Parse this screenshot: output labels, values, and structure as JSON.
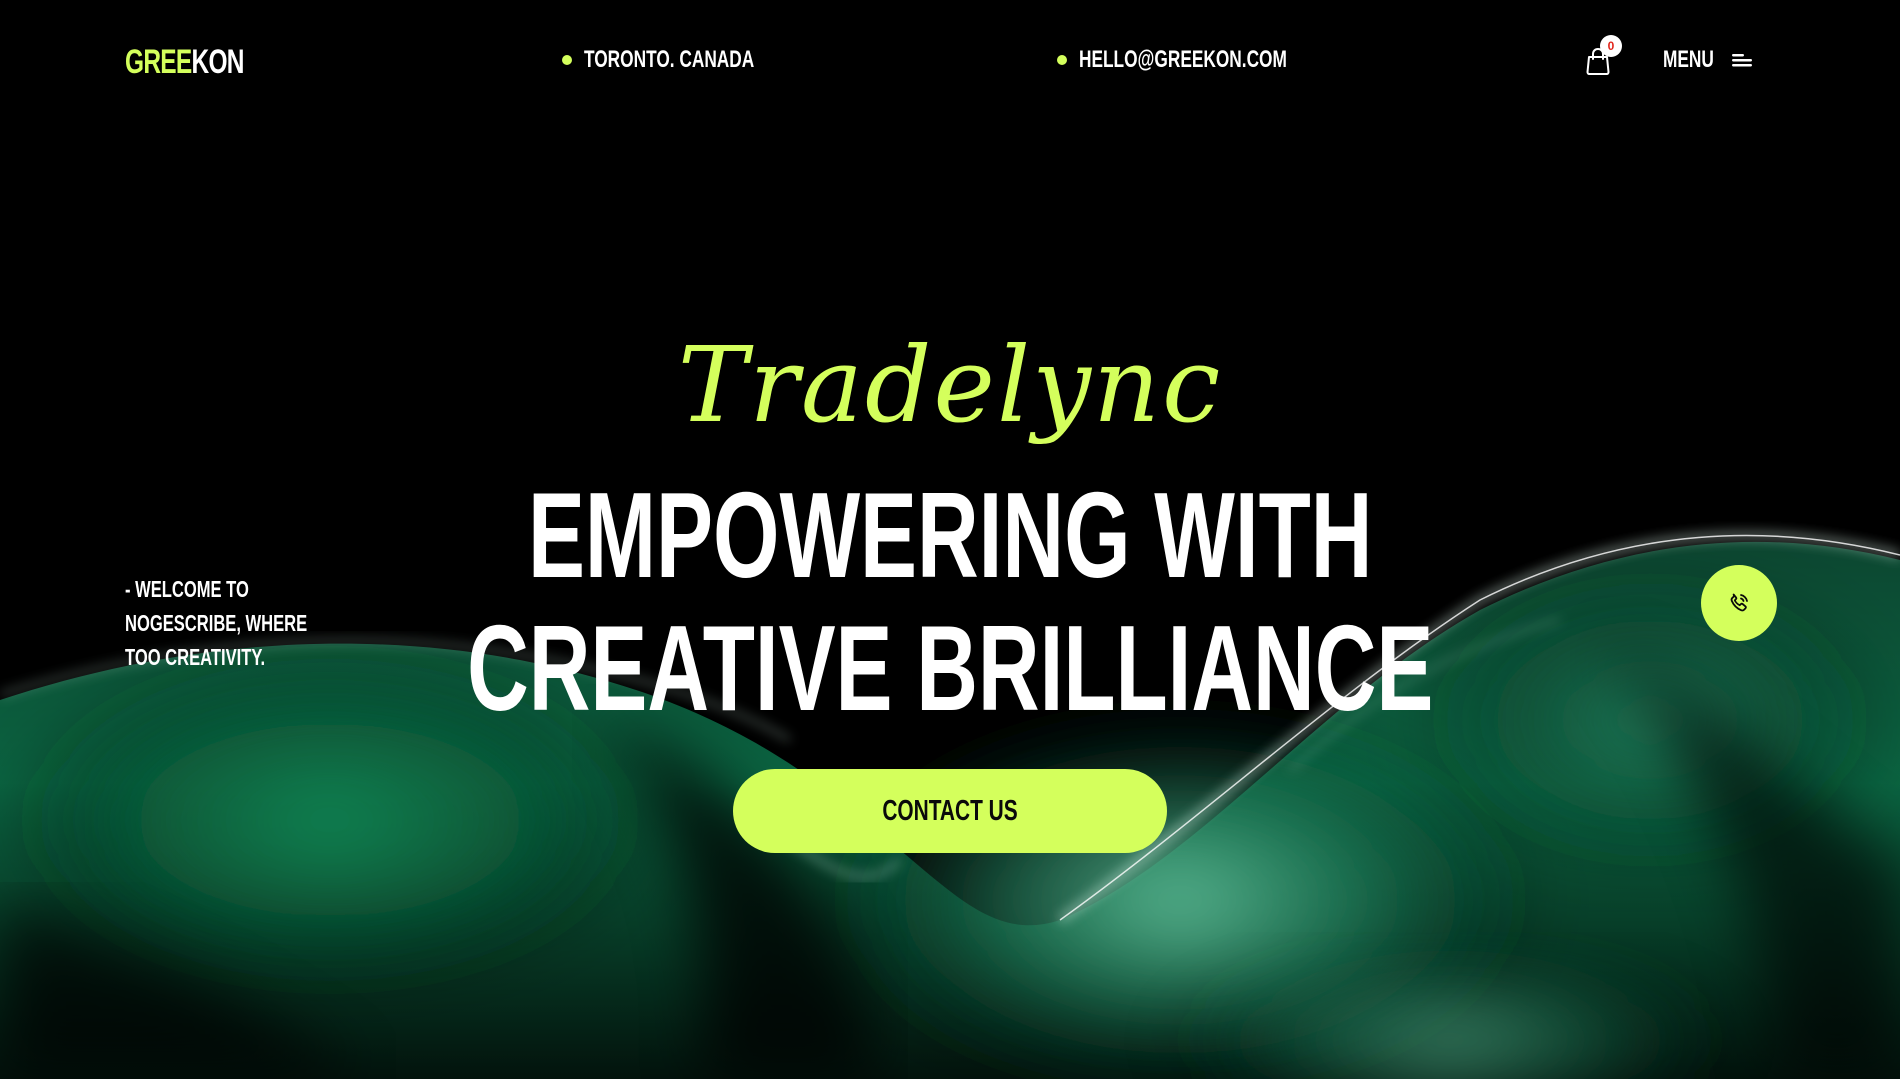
{
  "brand": {
    "logo_part_a": "GREE",
    "logo_part_b": "KON",
    "accent_color": "#d4ff5c"
  },
  "header": {
    "location": "TORONTO. CANADA",
    "email": "HELLO@GREEKON.COM",
    "cart_count": "0",
    "cart_icon": "shopping-bag-icon",
    "menu_label": "MENU",
    "menu_icon": "hamburger-menu-icon"
  },
  "hero": {
    "script_title": "Tradelync",
    "headline_line1": "EMPOWERING WITH",
    "headline_line2": "CREATIVE BRILLIANCE",
    "welcome_line1": "- WELCOME TO",
    "welcome_line2": "NOGESCRIBE, WHERE",
    "welcome_line3": "TOO CREATIVITY.",
    "cta_label": "CONTACT US",
    "phone_icon": "phone-call-icon"
  }
}
